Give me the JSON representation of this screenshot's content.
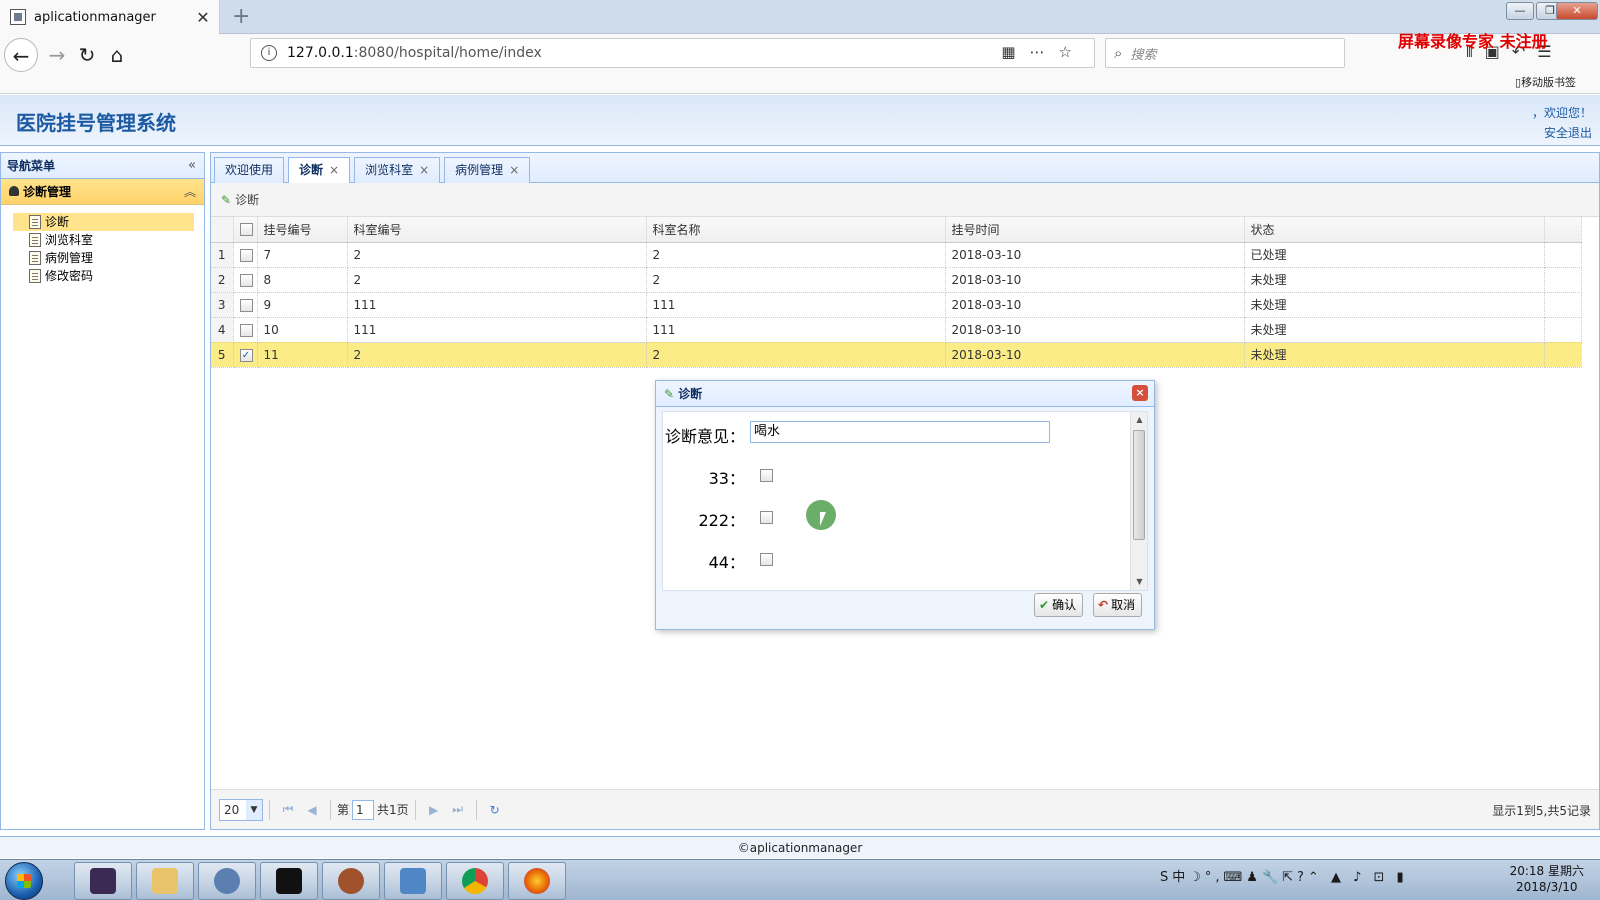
{
  "browser": {
    "tab_title": "aplicationmanager",
    "tab_close": "✕",
    "new_tab": "+",
    "url_host": "127.0.0.1",
    "url_path": ":8080/hospital/home/index",
    "search_placeholder": "搜索",
    "watermark": "屏幕录像专家 未注册",
    "mobile_bookmarks": "移动版书签"
  },
  "app": {
    "title": "医院挂号管理系统",
    "welcome": "，欢迎您！",
    "logout": "安全退出",
    "footer": "©aplicationmanager"
  },
  "sidebar": {
    "header": "导航菜单",
    "group": "诊断管理",
    "items": [
      "诊断",
      "浏览科室",
      "病例管理",
      "修改密码"
    ]
  },
  "tabs": [
    {
      "label": "欢迎使用",
      "closable": false
    },
    {
      "label": "诊断",
      "closable": true,
      "active": true
    },
    {
      "label": "浏览科室",
      "closable": true
    },
    {
      "label": "病例管理",
      "closable": true
    }
  ],
  "toolbar": {
    "diagnose_label": "诊断"
  },
  "grid": {
    "columns": [
      "挂号编号",
      "科室编号",
      "科室名称",
      "挂号时间",
      "状态"
    ],
    "rows": [
      {
        "num": "1",
        "id": "7",
        "dept_id": "2",
        "dept_name": "2",
        "time": "2018-03-10",
        "status": "已处理"
      },
      {
        "num": "2",
        "id": "8",
        "dept_id": "2",
        "dept_name": "2",
        "time": "2018-03-10",
        "status": "未处理"
      },
      {
        "num": "3",
        "id": "9",
        "dept_id": "111",
        "dept_name": "111",
        "time": "2018-03-10",
        "status": "未处理"
      },
      {
        "num": "4",
        "id": "10",
        "dept_id": "111",
        "dept_name": "111",
        "time": "2018-03-10",
        "status": "未处理"
      },
      {
        "num": "5",
        "id": "11",
        "dept_id": "2",
        "dept_name": "2",
        "time": "2018-03-10",
        "status": "未处理",
        "selected": true
      }
    ]
  },
  "pager": {
    "page_size": "20",
    "page_prefix": "第",
    "page_value": "1",
    "page_total": "共1页",
    "info": "显示1到5,共5记录"
  },
  "dialog": {
    "title": "诊断",
    "opinion_label": "诊断意见：",
    "opinion_value": "喝水",
    "options": [
      "33：",
      "222：",
      "44："
    ],
    "ok_label": "确认",
    "cancel_label": "取消"
  },
  "taskbar": {
    "clock_time": "20:18 星期六",
    "clock_date": "2018/3/10"
  },
  "colors": {
    "accent_blue": "#95b8e7",
    "title_blue": "#1c5aa3",
    "selection_yellow": "#fbec88",
    "watermark_red": "#e00000"
  }
}
